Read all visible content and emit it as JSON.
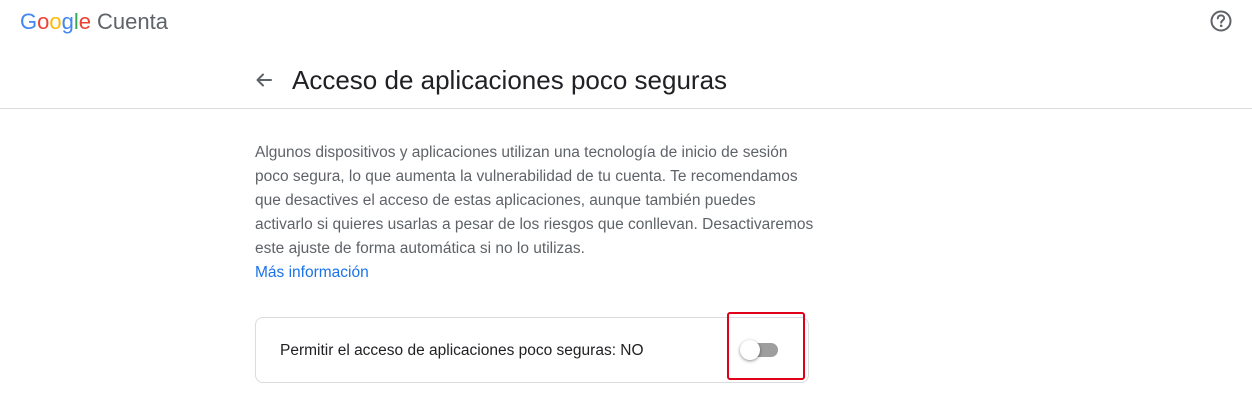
{
  "header": {
    "logo_letters": [
      "G",
      "o",
      "o",
      "g",
      "l",
      "e"
    ],
    "product_name": "Cuenta",
    "help_icon": "help-circle-icon"
  },
  "page": {
    "back_icon": "arrow-back-icon",
    "title": "Acceso de aplicaciones poco seguras"
  },
  "content": {
    "description": "Algunos dispositivos y aplicaciones utilizan una tecnología de inicio de sesión poco segura, lo que aumenta la vulnerabilidad de tu cuenta. Te recomendamos que desactives el acceso de estas aplicaciones, aunque también puedes activarlo si quieres usarlas a pesar de los riesgos que conllevan. Desactivaremos este ajuste de forma automática si no lo utilizas.",
    "more_info_link": "Más información"
  },
  "setting": {
    "label": "Permitir el acceso de aplicaciones poco seguras: NO",
    "enabled": false
  },
  "colors": {
    "link": "#1a73e8",
    "toggle_off_track": "#9e9e9e",
    "annotation": "#e0001a"
  }
}
